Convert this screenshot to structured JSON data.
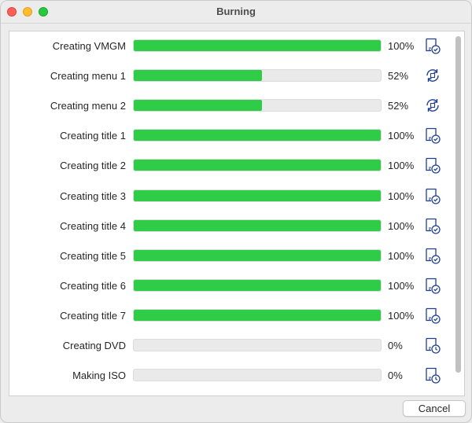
{
  "window": {
    "title": "Burning"
  },
  "tasks": [
    {
      "label": "Creating VMGM",
      "progress": 100,
      "percent_text": "100%",
      "status_icon": "done-document-check-icon"
    },
    {
      "label": "Creating menu 1",
      "progress": 52,
      "percent_text": "52%",
      "status_icon": "in-progress-refresh-icon"
    },
    {
      "label": "Creating menu 2",
      "progress": 52,
      "percent_text": "52%",
      "status_icon": "in-progress-refresh-icon"
    },
    {
      "label": "Creating title 1",
      "progress": 100,
      "percent_text": "100%",
      "status_icon": "done-document-check-icon"
    },
    {
      "label": "Creating title 2",
      "progress": 100,
      "percent_text": "100%",
      "status_icon": "done-document-check-icon"
    },
    {
      "label": "Creating title 3",
      "progress": 100,
      "percent_text": "100%",
      "status_icon": "done-document-check-icon"
    },
    {
      "label": "Creating title 4",
      "progress": 100,
      "percent_text": "100%",
      "status_icon": "done-document-check-icon"
    },
    {
      "label": "Creating title 5",
      "progress": 100,
      "percent_text": "100%",
      "status_icon": "done-document-check-icon"
    },
    {
      "label": "Creating title 6",
      "progress": 100,
      "percent_text": "100%",
      "status_icon": "done-document-check-icon"
    },
    {
      "label": "Creating title 7",
      "progress": 100,
      "percent_text": "100%",
      "status_icon": "done-document-check-icon"
    },
    {
      "label": "Creating DVD",
      "progress": 0,
      "percent_text": "0%",
      "status_icon": "pending-document-clock-icon"
    },
    {
      "label": "Making ISO",
      "progress": 0,
      "percent_text": "0%",
      "status_icon": "pending-document-clock-icon"
    }
  ],
  "buttons": {
    "cancel_label": "Cancel"
  },
  "colors": {
    "progress_fill": "#2ecc47",
    "icon_stroke": "#1f3f8f"
  }
}
